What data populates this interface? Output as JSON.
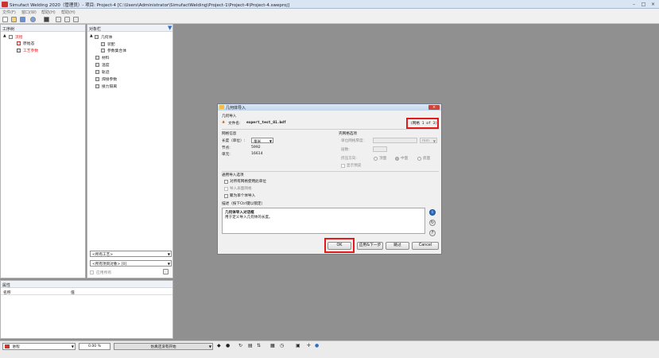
{
  "window": {
    "title": "Simufact Welding 2020（管理员）- 项目: Project-4 [C:\\Users\\Administrator\\SimufactWelding\\Project-1\\Project-4\\Project-4.sweproj]"
  },
  "menu": [
    "文件(F)",
    "窗口(W)",
    "帮助(H)",
    "帮助(H)"
  ],
  "process_panel": {
    "title": "工序树",
    "items": [
      "流程",
      "原始态",
      "工艺参数"
    ]
  },
  "objects_panel": {
    "title": "对象栏",
    "items": [
      "几何体",
      "装配",
      "参数集合体",
      "材料",
      "温度",
      "轨迹",
      "焊接参数",
      "接力隔离"
    ],
    "dropdown1": "<所有工艺>",
    "dropdown2": "<所有项目对象> [0]",
    "apply_label": "应用所有"
  },
  "properties_panel": {
    "title": "属性",
    "col_name": "名称",
    "col_value": "值"
  },
  "status": {
    "process_selector": "进程",
    "percent": "0.00 %",
    "simulation_text": "仿真还没有开始"
  },
  "dialog": {
    "title": "几何体导入",
    "section_import": "几何导入",
    "file_label": "文件名:",
    "file_name": "expert_test_01.bdf",
    "counter": "(网格 1 of 3)",
    "mesh_info_label": "网格信息",
    "length_label": "长度（单位）:",
    "length_unit": "毫米",
    "nodes_label": "节点:",
    "nodes_value": "5992",
    "elements_label": "单元:",
    "elements_value": "16614",
    "shell_label": "壳网格选项",
    "shell_thickness_label": "单位网格厚度:",
    "shell_thickness_unit": "mm",
    "layers_label": "层数:",
    "extrude_label": "挤压方向:",
    "top_label": "顶面",
    "middle_label": "中面",
    "bottom_label": "底面",
    "show_label": "显示预览",
    "general_label": "通用导入选项",
    "opt1": "对所有网格使用此单位",
    "opt2": "导入表面网格",
    "opt3": "聚为单个体导入",
    "desc_label": "描述（按下Ctrl键以锁定）",
    "desc_title": "几何体导入对话框",
    "desc_text": "用于定义导入几何体的长度。",
    "ok_button": "OK",
    "apply_next_button": "应用&下一步",
    "skip_button": "跳过",
    "cancel_button": "Cancel"
  },
  "colors": {
    "highlight": "#e31a1a",
    "background": "#909090"
  }
}
